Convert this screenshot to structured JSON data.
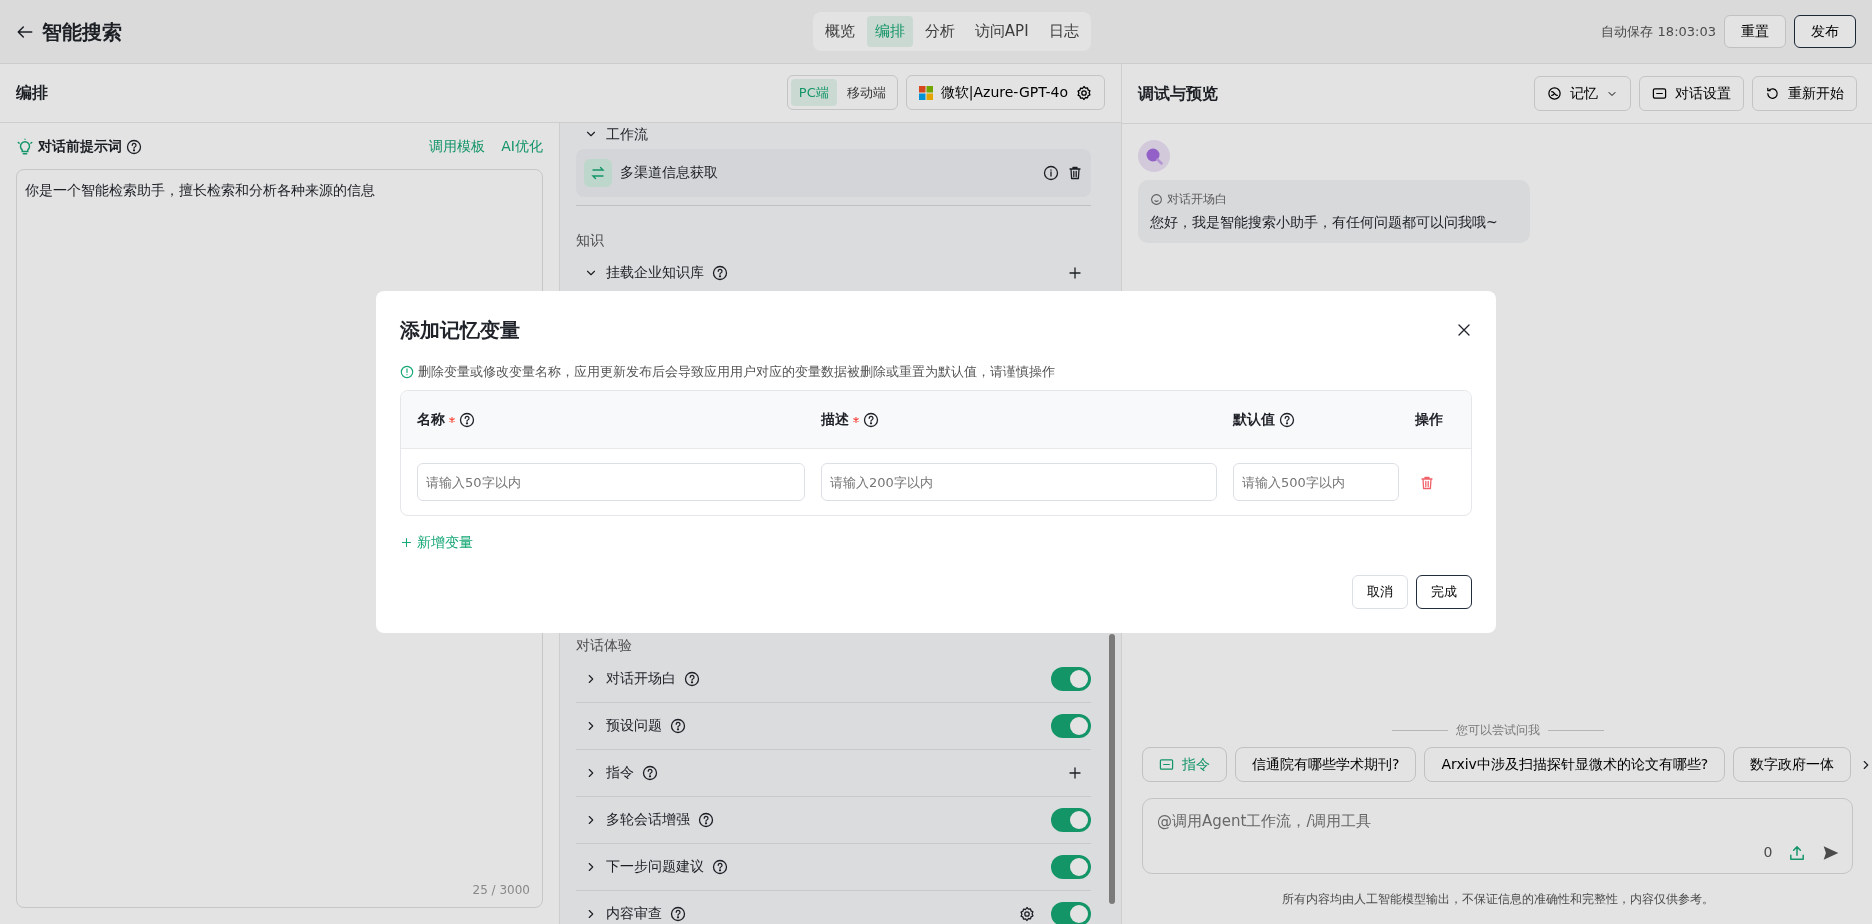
{
  "header": {
    "title": "智能搜索",
    "tabs": [
      {
        "label": "概览",
        "selected": false
      },
      {
        "label": "编排",
        "selected": true
      },
      {
        "label": "分析",
        "selected": false
      },
      {
        "label": "访问API",
        "selected": false
      },
      {
        "label": "日志",
        "selected": false
      }
    ],
    "autosave": "自动保存 18:03:03",
    "buttons": [
      {
        "label": "重置",
        "kind": "secondary"
      },
      {
        "label": "发布",
        "kind": "primary"
      }
    ]
  },
  "editor": {
    "title": "编排",
    "device_tabs": [
      {
        "label": "PC端",
        "selected": true
      },
      {
        "label": "移动端",
        "selected": false
      }
    ],
    "model": "微软|Azure-GPT-4o"
  },
  "prompt": {
    "label": "对话前提示词",
    "actions": [
      "调用模板",
      "AI优化"
    ],
    "value": "你是一个智能检索助手，擅长检索和分析各种来源的信息",
    "counter": "25 / 3000"
  },
  "skills": {
    "workflow_heading": "工作流",
    "workflows": [
      {
        "name": "多渠道信息获取"
      }
    ],
    "knowledge_heading": "知识",
    "knowledge_items": [
      {
        "label": "挂载企业知识库",
        "expanded": true
      }
    ],
    "experience_heading": "对话体验",
    "features": [
      {
        "label": "对话开场白",
        "kind": "toggle",
        "expanded": false,
        "on": true,
        "settings": false
      },
      {
        "label": "预设问题",
        "kind": "toggle",
        "expanded": false,
        "on": true,
        "settings": false
      },
      {
        "label": "指令",
        "kind": "add",
        "expanded": false
      },
      {
        "label": "多轮会话增强",
        "kind": "toggle",
        "expanded": false,
        "on": true,
        "settings": false
      },
      {
        "label": "下一步问题建议",
        "kind": "toggle",
        "expanded": false,
        "on": true,
        "settings": false
      },
      {
        "label": "内容审查",
        "kind": "toggle",
        "expanded": false,
        "on": true,
        "settings": true
      }
    ]
  },
  "preview": {
    "title": "调试与预览",
    "buttons": [
      {
        "label": "记忆",
        "kind": "dropdown"
      },
      {
        "label": "对话设置",
        "kind": "settings"
      },
      {
        "label": "重新开始",
        "kind": "restart"
      }
    ],
    "opening": {
      "label": "对话开场白",
      "text": "您好，我是智能搜索小助手，有任何问题都可以问我哦~"
    },
    "suggestions_label": "您可以尝试问我",
    "chips": [
      {
        "label": "指令",
        "kind": "command"
      },
      {
        "label": "信通院有哪些学术期刊?",
        "kind": "question"
      },
      {
        "label": "Arxiv中涉及扫描探针显微术的论文有哪些?",
        "kind": "question"
      },
      {
        "label": "数字政府一体",
        "kind": "question"
      }
    ],
    "input": {
      "placeholder": "@调用Agent工作流，/调用工具",
      "counter": "0"
    },
    "disclaimer": "所有内容均由人工智能模型输出，不保证信息的准确性和完整性，内容仅供参考。"
  },
  "dialog": {
    "title": "添加记忆变量",
    "warning": "删除变量或修改变量名称，应用更新发布后会导致应用用户对应的变量数据被删除或重置为默认值，请谨慎操作",
    "columns": [
      {
        "label": "名称",
        "required": true,
        "help": true
      },
      {
        "label": "描述",
        "required": true,
        "help": true
      },
      {
        "label": "默认值",
        "required": false,
        "help": true
      },
      {
        "label": "操作",
        "required": false,
        "help": false
      }
    ],
    "rows": [
      {
        "name_placeholder": "请输入50字以内",
        "description_placeholder": "请输入200字以内",
        "default_placeholder": "请输入500字以内"
      }
    ],
    "add_label": "新增变量",
    "buttons": [
      {
        "label": "取消",
        "kind": "secondary"
      },
      {
        "label": "完成",
        "kind": "primary"
      }
    ]
  }
}
